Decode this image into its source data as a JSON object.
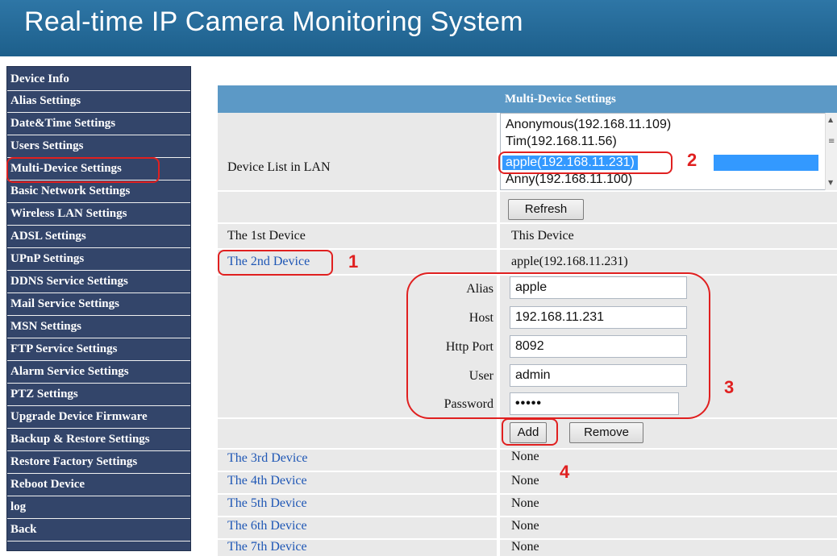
{
  "header": {
    "title": "Real-time IP Camera Monitoring System"
  },
  "sidebar": {
    "items": [
      "Device Info",
      "Alias Settings",
      "Date&Time Settings",
      "Users Settings",
      "Multi-Device Settings",
      "Basic Network Settings",
      "Wireless LAN Settings",
      "ADSL Settings",
      "UPnP Settings",
      "DDNS Service Settings",
      "Mail Service Settings",
      "MSN Settings",
      "FTP Service Settings",
      "Alarm Service Settings",
      "PTZ Settings",
      "Upgrade Device Firmware",
      "Backup & Restore Settings",
      "Restore Factory Settings",
      "Reboot Device",
      "log",
      "Back"
    ]
  },
  "panel": {
    "title": "Multi-Device Settings",
    "device_list_label": "Device List in LAN",
    "device_list": [
      "Anonymous(192.168.11.109)",
      "Tim(192.168.11.56)",
      "apple(192.168.11.231)",
      "Anny(192.168.11.100)"
    ],
    "selected_device": "apple(192.168.11.231)",
    "refresh_label": "Refresh",
    "device1": {
      "label": "The 1st Device",
      "value": "This Device"
    },
    "device2": {
      "label": "The 2nd Device",
      "value": "apple(192.168.11.231)"
    },
    "fields": {
      "alias_label": "Alias",
      "alias_value": "apple",
      "host_label": "Host",
      "host_value": "192.168.11.231",
      "http_port_label": "Http Port",
      "http_port_value": "8092",
      "user_label": "User",
      "user_value": "admin",
      "password_label": "Password",
      "password_value": "•••••"
    },
    "add_label": "Add",
    "remove_label": "Remove",
    "other_devices": [
      {
        "label": "The 3rd Device",
        "value": "None"
      },
      {
        "label": "The 4th Device",
        "value": "None"
      },
      {
        "label": "The 5th Device",
        "value": "None"
      },
      {
        "label": "The 6th Device",
        "value": "None"
      },
      {
        "label": "The 7th Device",
        "value": "None"
      }
    ]
  },
  "annotations": [
    "1",
    "2",
    "3",
    "4"
  ],
  "colors": {
    "header": "#2e76a6",
    "sidebar": "#33456a",
    "panel_title": "#5c99c6",
    "annotation": "#e02020",
    "selection": "#3399ff"
  }
}
